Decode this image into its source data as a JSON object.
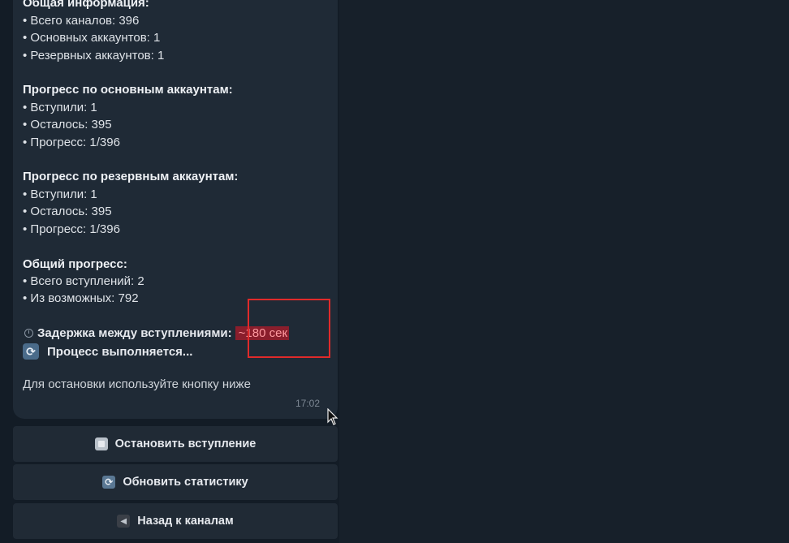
{
  "message": {
    "general_heading": "Общая информация:",
    "general_items": [
      "• Всего каналов: 396",
      "• Основных аккаунтов: 1",
      "• Резервных аккаунтов: 1"
    ],
    "main_heading": "Прогресс по основным аккаунтам:",
    "main_items": [
      "• Вступили: 1",
      "• Осталось: 395",
      "• Прогресс: 1/396"
    ],
    "reserve_heading": "Прогресс по резервным аккаунтам:",
    "reserve_items": [
      "• Вступили: 1",
      "• Осталось: 395",
      "• Прогресс: 1/396"
    ],
    "total_heading": "Общий прогресс:",
    "total_items": [
      "• Всего вступлений: 2",
      "• Из возможных: 792"
    ],
    "delay_label": "Задержка между вступлениями:",
    "delay_value": "~180 сек",
    "process_label": "Процесс выполняется...",
    "stop_hint": "Для остановки используйте кнопку ниже",
    "time": "17:02"
  },
  "keyboard": {
    "stop_label": "Остановить вступление",
    "refresh_label": "Обновить статистику",
    "back_label": "Назад к каналам"
  }
}
